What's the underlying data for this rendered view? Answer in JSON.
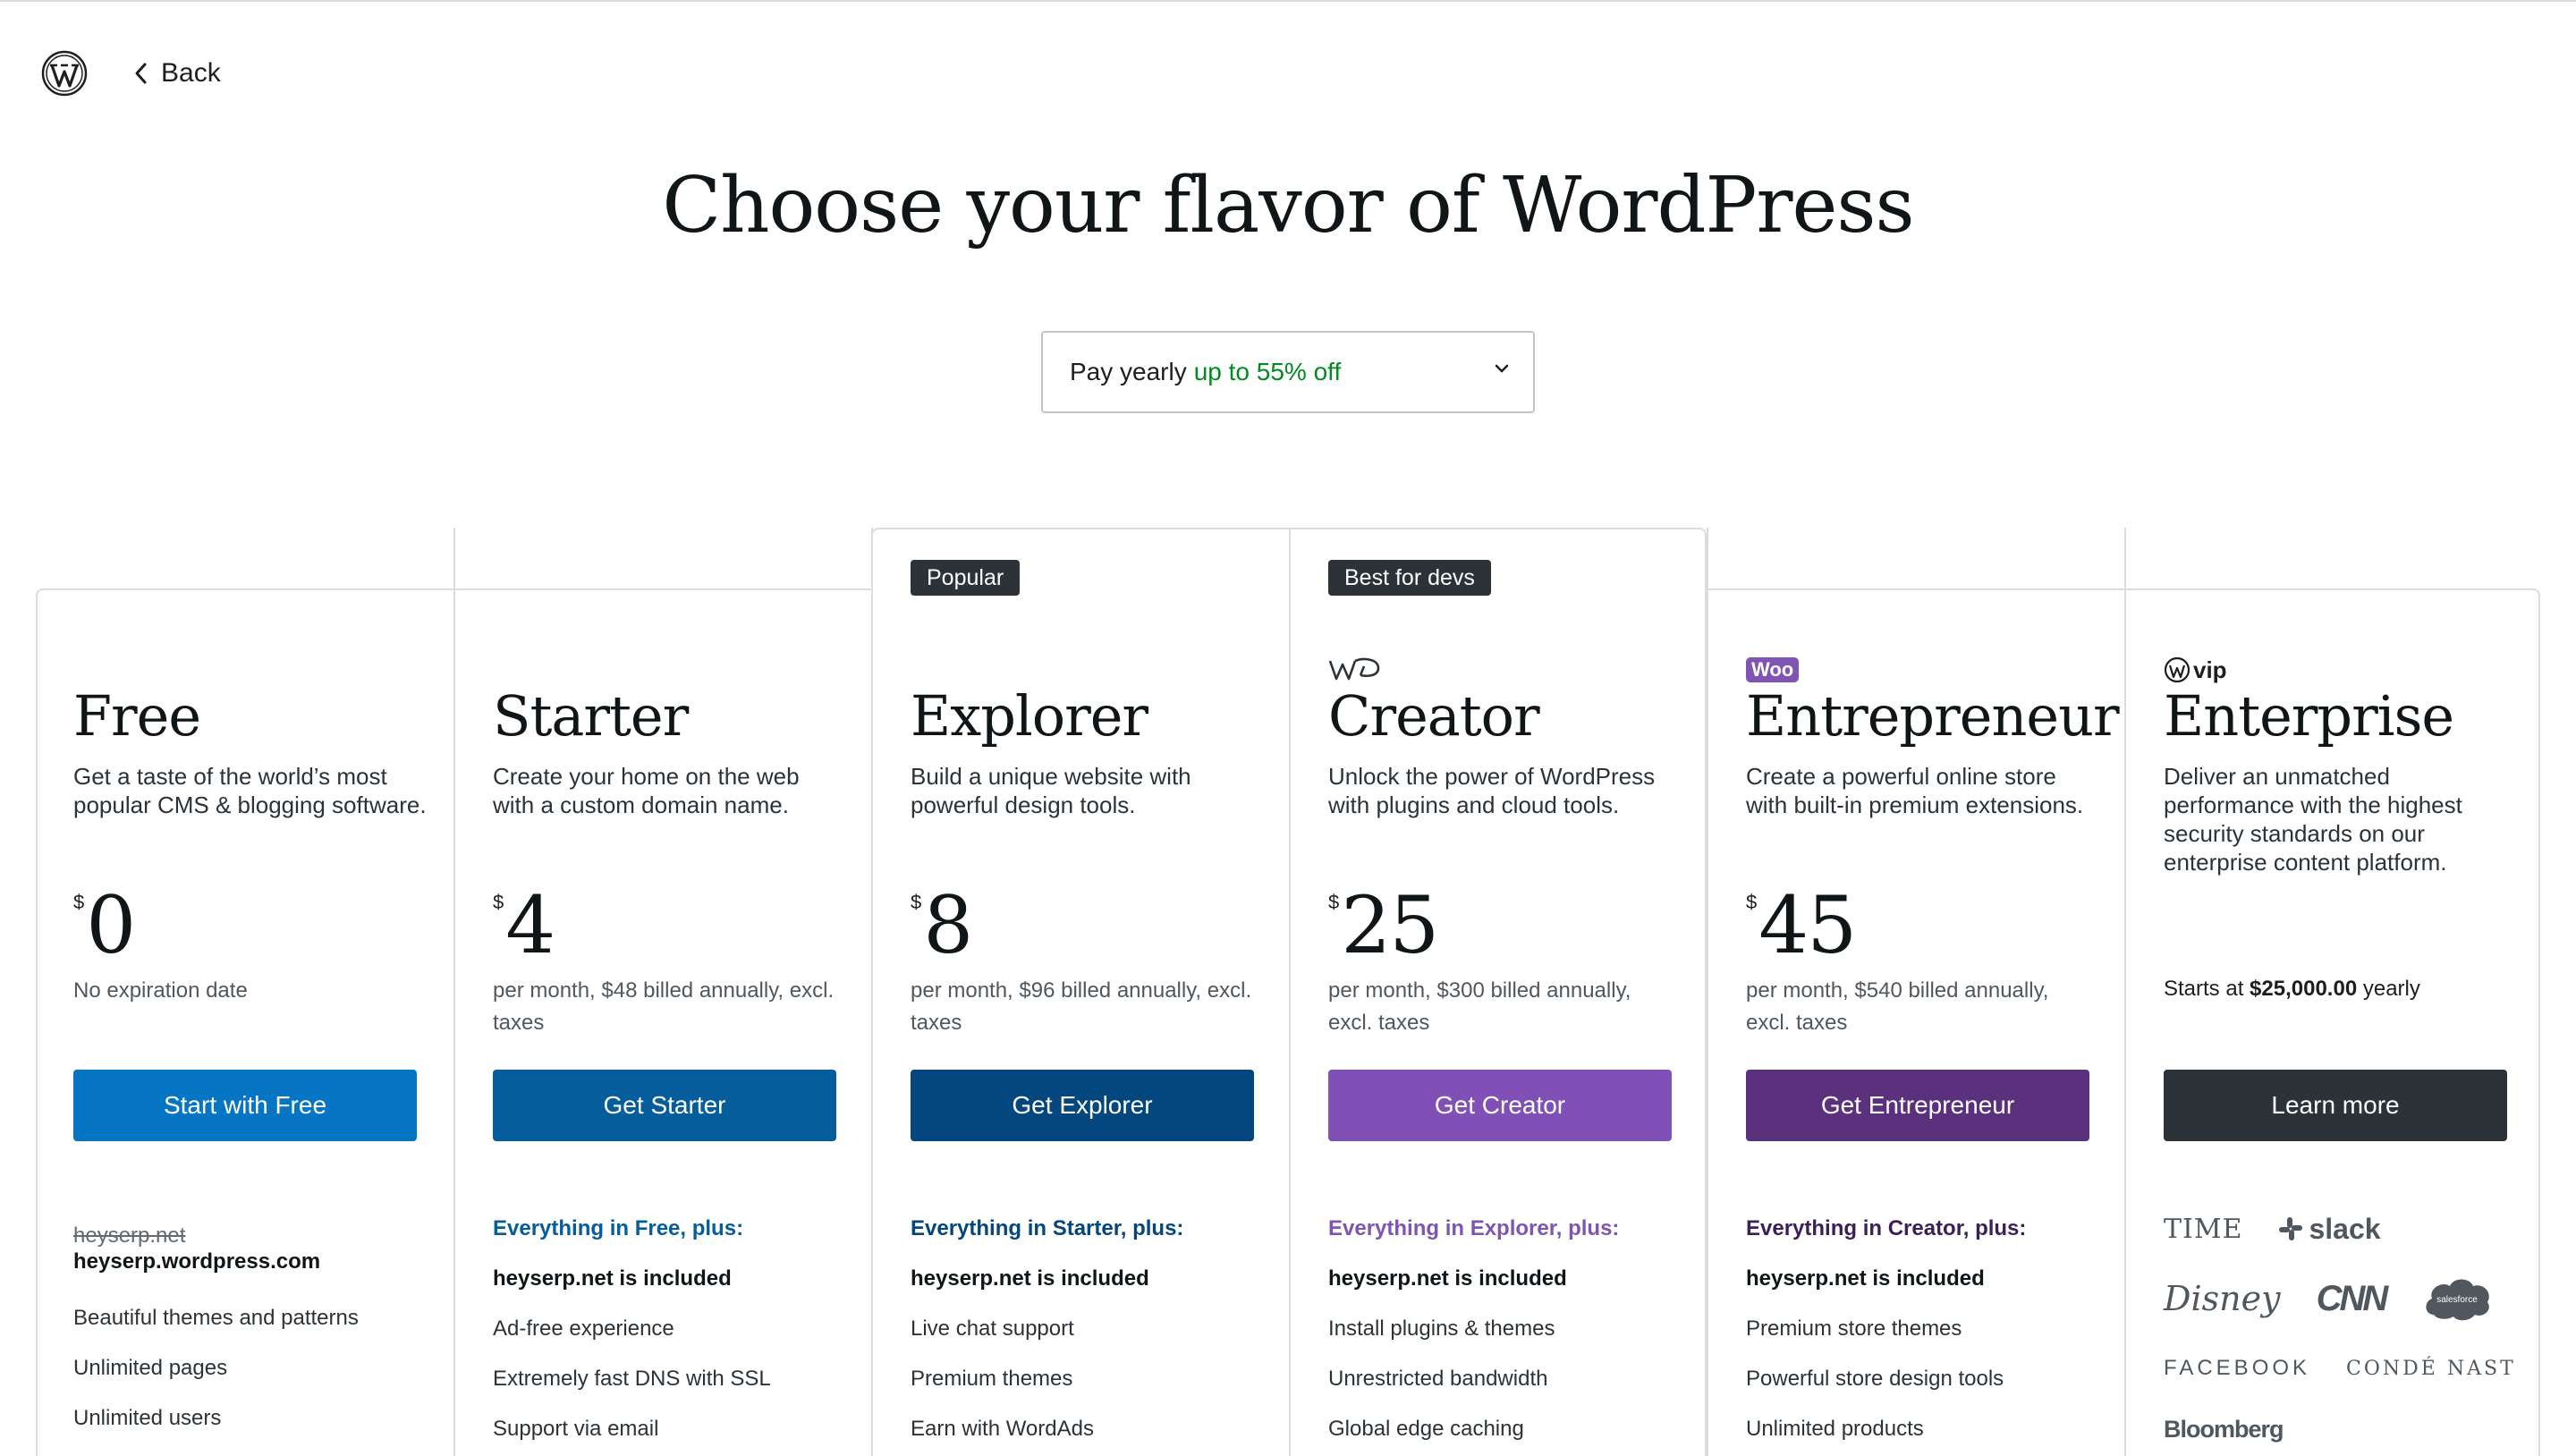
{
  "header": {
    "back_label": "Back"
  },
  "page_title": "Choose your flavor of WordPress",
  "billing": {
    "label": "Pay yearly",
    "discount": "up to 55% off"
  },
  "plans": [
    {
      "name": "Free",
      "description": "Get a taste of the world’s most popular CMS & blogging software.",
      "currency": "$",
      "price": "0",
      "price_note": "No expiration date",
      "cta": "Start with Free",
      "cta_color": "#0675c4",
      "domain_struck": "heyserp.net",
      "domain_included": "heyserp.wordpress.com",
      "features": [
        "Beautiful themes and patterns",
        "Unlimited pages",
        "Unlimited users"
      ]
    },
    {
      "name": "Starter",
      "description": "Create your home on the web with a custom domain name.",
      "currency": "$",
      "price": "4",
      "price_note": "per month, $48 billed annually, excl. taxes",
      "cta": "Get Starter",
      "cta_color": "#055d9c",
      "features_header": "Everything in Free, plus:",
      "header_color": "#055d9c",
      "features": [
        "heyserp.net is included",
        "Ad-free experience",
        "Extremely fast DNS with SSL",
        "Support via email"
      ]
    },
    {
      "name": "Explorer",
      "badge": "Popular",
      "description": "Build a unique website with powerful design tools.",
      "currency": "$",
      "price": "8",
      "price_note": "per month, $96 billed annually, excl. taxes",
      "cta": "Get Explorer",
      "cta_color": "#04477f",
      "features_header": "Everything in Starter, plus:",
      "header_color": "#04477f",
      "features": [
        "heyserp.net is included",
        "Live chat support",
        "Premium themes",
        "Earn with WordAds"
      ]
    },
    {
      "name": "Creator",
      "badge": "Best for devs",
      "logo": "wp-cloud-icon",
      "description": "Unlock the power of WordPress with plugins and cloud tools.",
      "currency": "$",
      "price": "25",
      "price_note": "per month, $300 billed annually, excl. taxes",
      "cta": "Get Creator",
      "cta_color": "#8150b7",
      "features_header": "Everything in Explorer, plus:",
      "header_color": "#7f54b3",
      "features": [
        "heyserp.net is included",
        "Install plugins & themes",
        "Unrestricted bandwidth",
        "Global edge caching"
      ]
    },
    {
      "name": "Entrepreneur",
      "logo": "woo-logo",
      "logo_text": "Woo",
      "description": "Create a powerful online store with built-in premium extensions.",
      "currency": "$",
      "price": "45",
      "price_note": "per month, $540 billed annually, excl. taxes",
      "cta": "Get Entrepreneur",
      "cta_color": "#5b307d",
      "features_header": "Everything in Creator, plus:",
      "header_color": "#3c1f5a",
      "features": [
        "heyserp.net is included",
        "Premium store themes",
        "Powerful store design tools",
        "Unlimited products"
      ]
    },
    {
      "name": "Enterprise",
      "logo": "wp-vip-logo",
      "logo_text": "vip",
      "description": "Deliver an unmatched performance with the highest security standards on our enterprise content platform.",
      "starts_prefix": "Starts at",
      "starts_price": "$25,000.00",
      "starts_suffix": "yearly",
      "cta": "Learn more",
      "cta_color": "#2c3338",
      "client_logos": [
        "TIME",
        "slack",
        "Disney",
        "CNN",
        "salesforce",
        "FACEBOOK",
        "CONDÉ NAST",
        "Bloomberg"
      ]
    }
  ]
}
